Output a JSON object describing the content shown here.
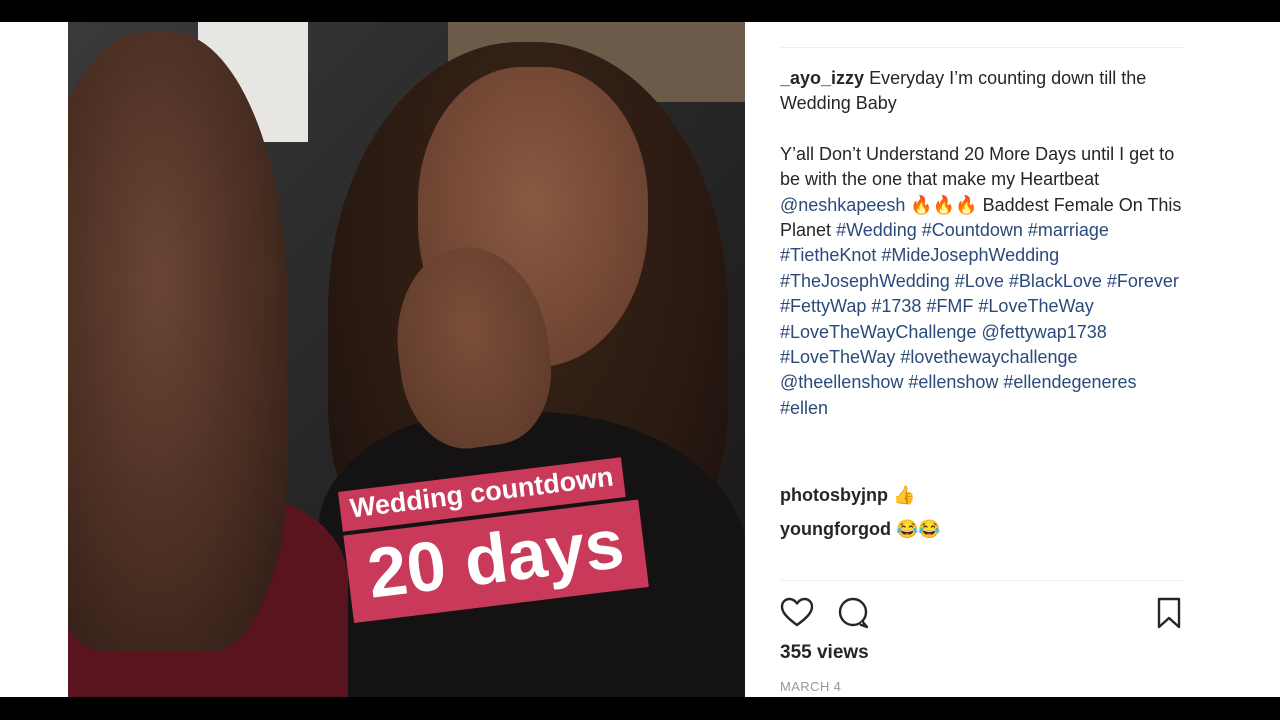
{
  "sticker": {
    "line1": "Wedding countdown",
    "line2": "20 days"
  },
  "post": {
    "username": "_ayo_izzy",
    "caption_line1": "Everyday I’m counting down till the Wedding Baby",
    "caption_line2": "Y’all Don’t Understand 20 More Days until I get to be with the one that make my Heartbeat",
    "mention": "@neshkapeesh",
    "fire_emojis": "🔥🔥🔥",
    "caption_line3": "Baddest Female On This Planet",
    "tags": "#Wedding #Countdown #marriage #TietheKnot #MideJosephWedding #TheJosephWedding #Love #BlackLove #Forever #FettyWap #1738 #FMF #LoveTheWay #LoveTheWayChallenge @fettywap1738 #LoveTheWay #lovethewaychallenge @theellenshow #ellenshow #ellendegeneres #ellen"
  },
  "comments": [
    {
      "username": "photosbyjnp",
      "emoji": "👍"
    },
    {
      "username": "youngforgod",
      "emoji": "😂😂"
    }
  ],
  "stats": {
    "views": "355 views",
    "date": "MARCH 4"
  },
  "colors": {
    "sticker_bg": "#c93a5a",
    "link": "#2b4a7a",
    "text": "#262626",
    "muted": "#999999"
  },
  "icons": [
    "heart-icon",
    "comment-icon",
    "bookmark-icon"
  ]
}
